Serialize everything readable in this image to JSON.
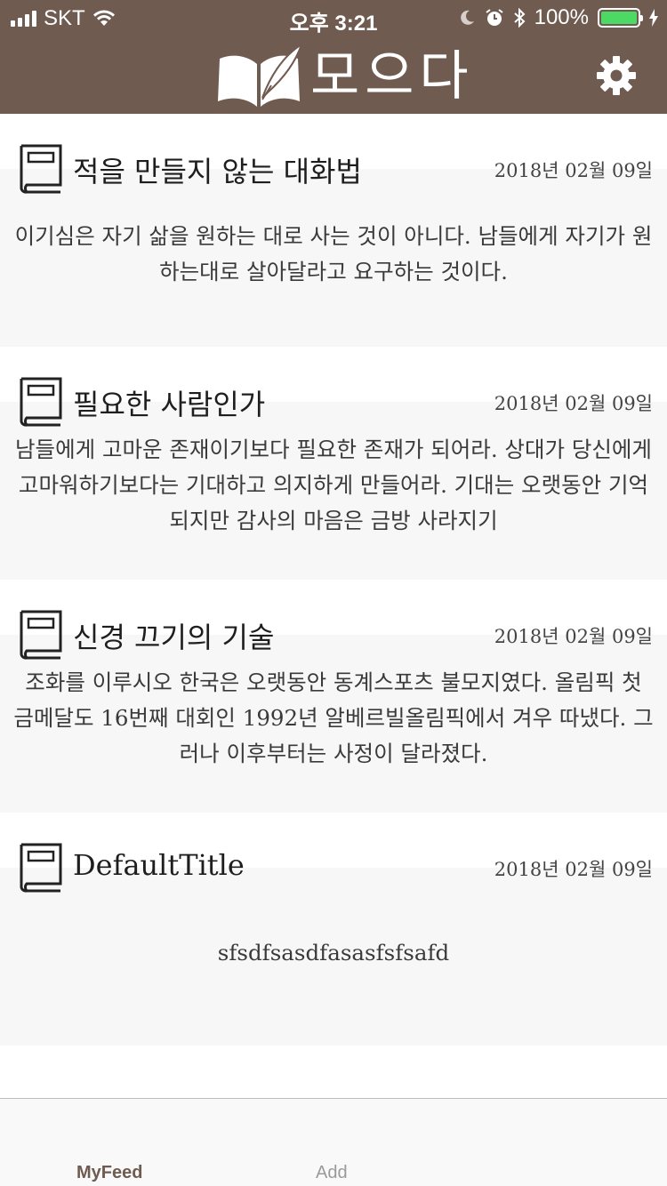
{
  "status_bar": {
    "carrier": "SKT",
    "time": "오후 3:21",
    "battery": "100%",
    "icons": [
      "signal-icon",
      "wifi-icon",
      "moon-icon",
      "alarm-icon",
      "bluetooth-icon",
      "battery-icon",
      "charging-icon"
    ]
  },
  "header": {
    "title": "모으다",
    "logo_icon": "open-book-quill-icon",
    "settings_icon": "gear-icon",
    "background_color": "#6f5b50"
  },
  "feed": {
    "items": [
      {
        "title": "적을 만들지 않는 대화법",
        "date": "2018년 02월 09일",
        "body": "이기심은 자기 삶을 원하는 대로 사는 것이 아니다. 남들에게 자기가 원하는대로 살아달라고 요구하는 것이다."
      },
      {
        "title": "필요한 사람인가",
        "date": "2018년 02월 09일",
        "body": "남들에게 고마운 존재이기보다 필요한 존재가 되어라. 상대가 당신에게 고마워하기보다는 기대하고 의지하게 만들어라. 기대는 오랫동안 기억되지만 감사의 마음은 금방 사라지기"
      },
      {
        "title": "신경 끄기의 기술",
        "date": "2018년 02월 09일",
        "body": "조화를 이루시오 한국은 오랫동안 동계스포츠 불모지였다. 올림픽 첫 금메달도 16번째 대회인 1992년 알베르빌올림픽에서 겨우 따냈다. 그러나 이후부터는 사정이 달라졌다."
      },
      {
        "title": "DefaultTitle",
        "date": "2018년 02월 09일",
        "body": "sfsdfsasdfasasfsfsafd"
      }
    ]
  },
  "tabbar": {
    "tabs": [
      {
        "label": "MyFeed",
        "active": true
      },
      {
        "label": "Add",
        "active": false
      }
    ],
    "active_color": "#6f5b50",
    "inactive_color": "#9a9a9a"
  }
}
